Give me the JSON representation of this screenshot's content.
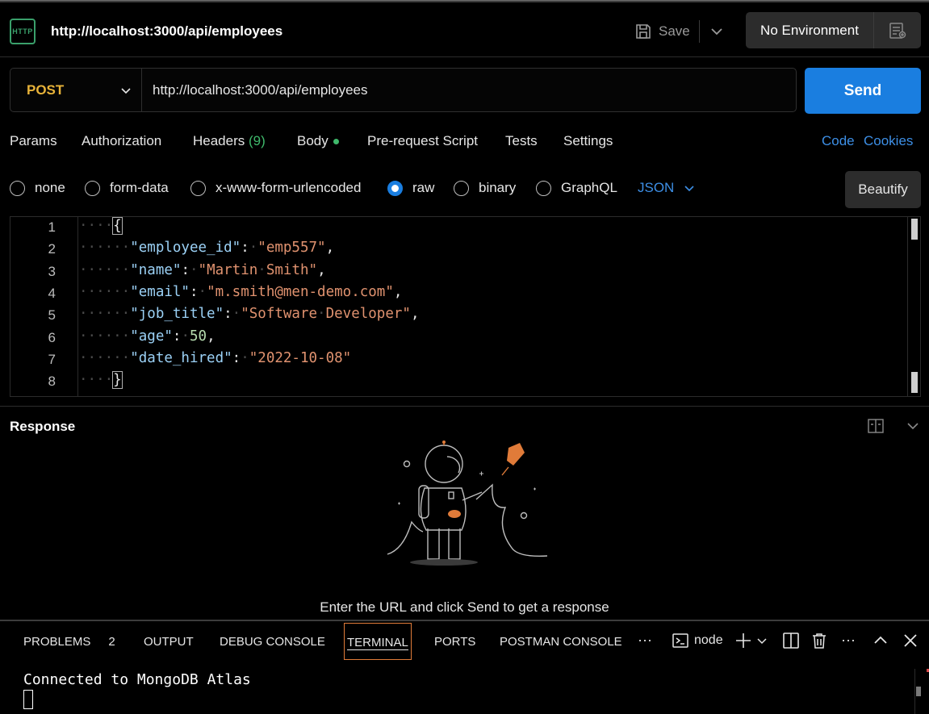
{
  "header": {
    "icon_label": "HTTP",
    "title": "http://localhost:3000/api/employees",
    "save_label": "Save",
    "environment": "No Environment"
  },
  "request": {
    "method": "POST",
    "url": "http://localhost:3000/api/employees",
    "send_label": "Send"
  },
  "tabs": {
    "params": "Params",
    "authorization": "Authorization",
    "headers": "Headers",
    "headers_count": "(9)",
    "body": "Body",
    "pre_request": "Pre-request Script",
    "tests": "Tests",
    "settings": "Settings",
    "code": "Code",
    "cookies": "Cookies"
  },
  "body_types": {
    "options": [
      "none",
      "form-data",
      "x-www-form-urlencoded",
      "raw",
      "binary",
      "GraphQL"
    ],
    "selected": "raw",
    "format": "JSON",
    "beautify_label": "Beautify"
  },
  "editor": {
    "line_numbers": [
      "1",
      "2",
      "3",
      "4",
      "5",
      "6",
      "7",
      "8"
    ],
    "lines": [
      {
        "indent": "····",
        "tokens": [
          {
            "t": "{",
            "c": "brace"
          }
        ]
      },
      {
        "indent": "······",
        "tokens": [
          {
            "t": "\"employee_id\"",
            "c": "key"
          },
          {
            "t": ":·",
            "c": "p"
          },
          {
            "t": "\"emp557\"",
            "c": "str"
          },
          {
            "t": ",",
            "c": "p"
          }
        ]
      },
      {
        "indent": "······",
        "tokens": [
          {
            "t": "\"name\"",
            "c": "key"
          },
          {
            "t": ":·",
            "c": "p"
          },
          {
            "t": "\"Martin·Smith\"",
            "c": "str"
          },
          {
            "t": ",",
            "c": "p"
          }
        ]
      },
      {
        "indent": "······",
        "tokens": [
          {
            "t": "\"email\"",
            "c": "key"
          },
          {
            "t": ":·",
            "c": "p"
          },
          {
            "t": "\"m.smith@men-demo.com\"",
            "c": "str"
          },
          {
            "t": ",",
            "c": "p"
          }
        ]
      },
      {
        "indent": "······",
        "tokens": [
          {
            "t": "\"job_title\"",
            "c": "key"
          },
          {
            "t": ":·",
            "c": "p"
          },
          {
            "t": "\"Software·Developer\"",
            "c": "str"
          },
          {
            "t": ",",
            "c": "p"
          }
        ]
      },
      {
        "indent": "······",
        "tokens": [
          {
            "t": "\"age\"",
            "c": "key"
          },
          {
            "t": ":·",
            "c": "p"
          },
          {
            "t": "50",
            "c": "num"
          },
          {
            "t": ",",
            "c": "p"
          }
        ]
      },
      {
        "indent": "······",
        "tokens": [
          {
            "t": "\"date_hired\"",
            "c": "key"
          },
          {
            "t": ":·",
            "c": "p"
          },
          {
            "t": "\"2022-10-08\"",
            "c": "str"
          }
        ]
      },
      {
        "indent": "····",
        "tokens": [
          {
            "t": "}",
            "c": "brace"
          }
        ]
      }
    ]
  },
  "response": {
    "title": "Response",
    "hint": "Enter the URL and click Send to get a response"
  },
  "panel": {
    "problems": "PROBLEMS",
    "problems_count": "2",
    "output": "OUTPUT",
    "debug_console": "DEBUG CONSOLE",
    "terminal": "TERMINAL",
    "ports": "PORTS",
    "postman_console": "POSTMAN CONSOLE",
    "more": "···",
    "shell": "node",
    "more2": "···"
  },
  "terminal": {
    "output": "Connected to MongoDB Atlas"
  },
  "colors": {
    "accent_blue": "#1a7ee0",
    "method_yellow": "#e8b339",
    "success_green": "#3fb96b",
    "link_blue": "#3d8fe6",
    "active_tab_border": "#e07b39"
  }
}
